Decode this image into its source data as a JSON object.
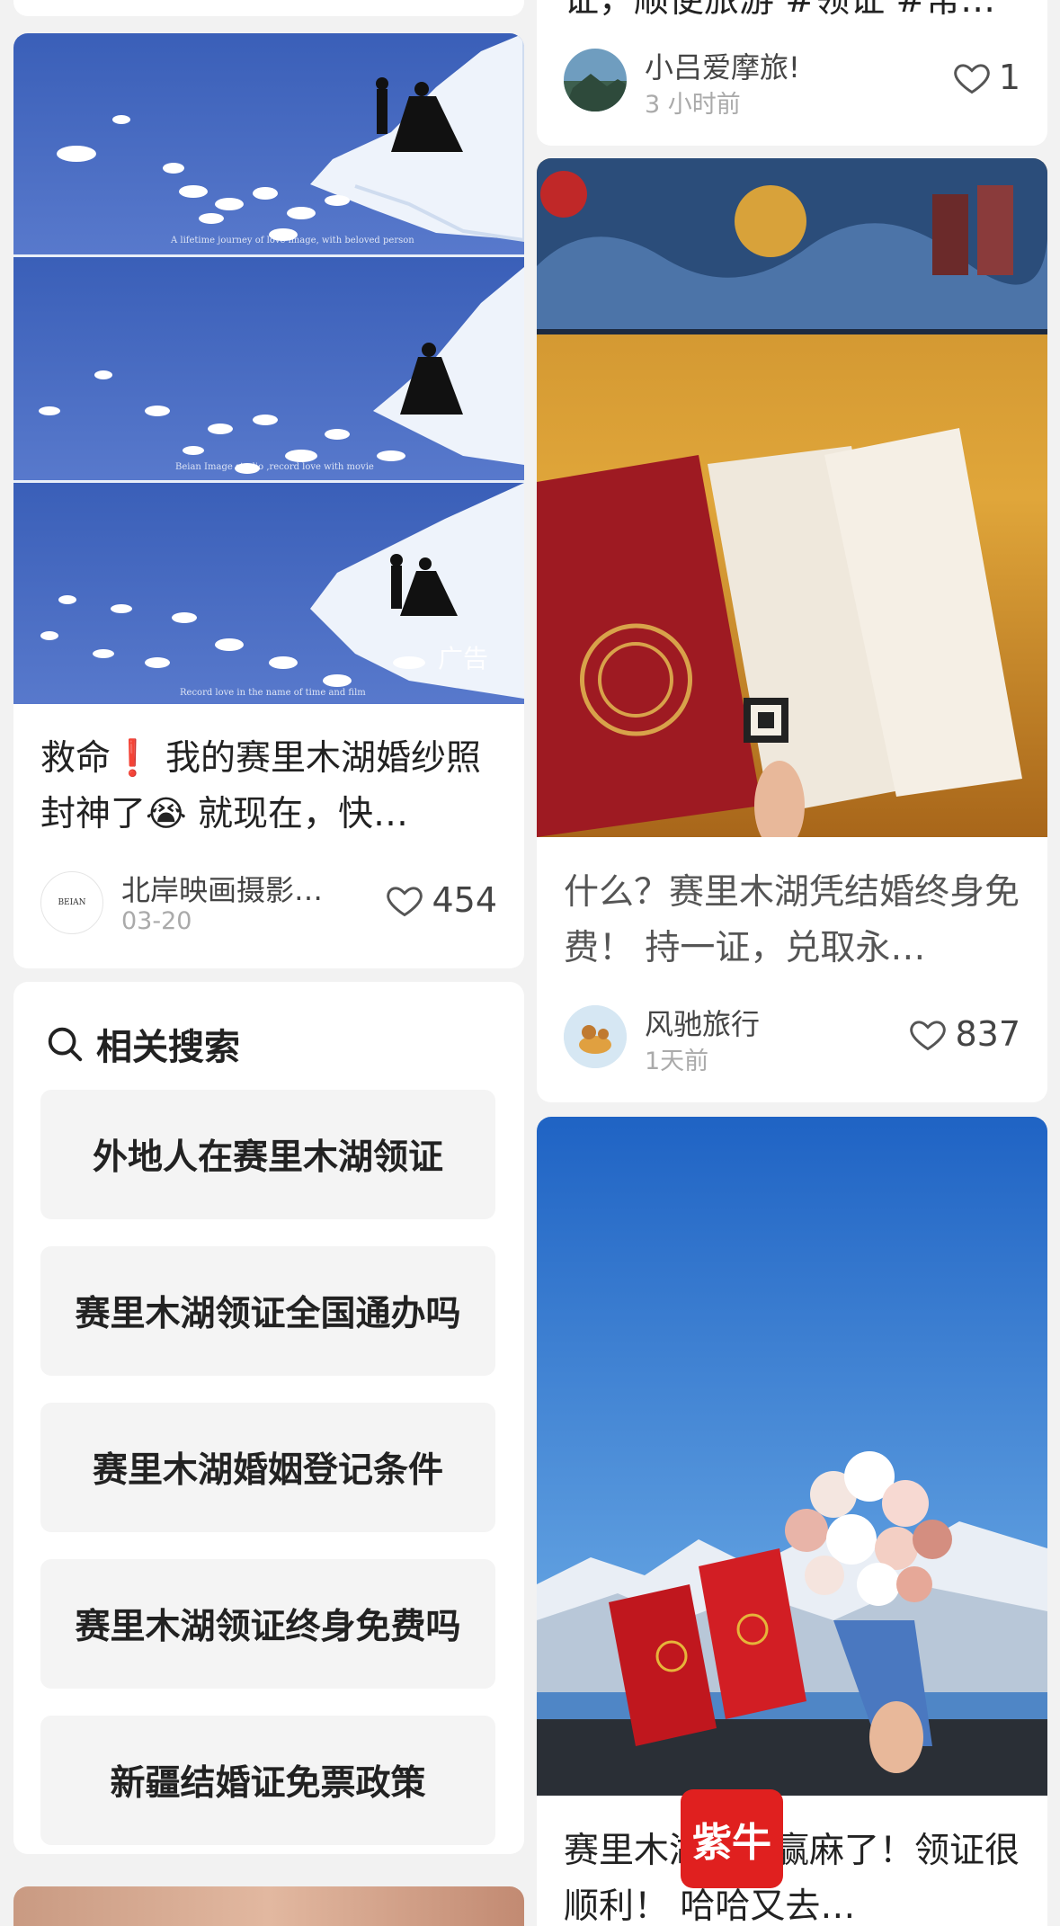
{
  "top_right_card": {
    "title_tail": "证，顺便旅游 #领证 #常…",
    "author": "小吕爱摩旅!",
    "time": "3 小时前",
    "likes": "1"
  },
  "ad_card": {
    "title": "救命❗ 我的赛里木湖婚纱照封神了😭 就现在，快…",
    "ad_label": "广告",
    "watermark_1": "A lifetime journey of love image, with beloved person",
    "watermark_2": "Beian Image studio ,record love with movie",
    "watermark_3": "Record love in the name of time and film",
    "author": "北岸映画摄影…",
    "avatar_text": "BEIAN",
    "time": "03-20",
    "likes": "454"
  },
  "related_search": {
    "heading": "相关搜索",
    "items": [
      "外地人在赛里木湖领证",
      "赛里木湖领证全国通办吗",
      "赛里木湖婚姻登记条件",
      "赛里木湖领证终身免费吗",
      "新疆结婚证免票政策"
    ]
  },
  "card_2": {
    "title": "什么？赛里木湖凭结婚终身免费！ 持一证，兑取永…",
    "author": "风驰旅行",
    "time": "1天前",
    "likes": "837"
  },
  "card_3": {
    "title": "赛里木湖这波赢麻了！领证很顺利！ 哈哈又去…"
  },
  "floating_logo": {
    "text": "紫牛"
  },
  "colors": {
    "background": "#f2f2f2",
    "card": "#ffffff",
    "chip": "#f4f4f4",
    "logo_red": "#e0201f"
  }
}
